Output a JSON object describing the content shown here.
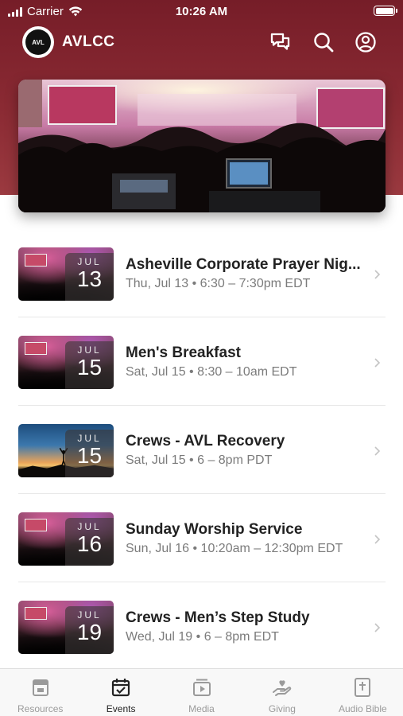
{
  "status_bar": {
    "carrier": "Carrier",
    "time": "10:26 AM"
  },
  "app_bar": {
    "logo_text": "AVL",
    "title": "AVLCC",
    "icons": [
      "chat-icon",
      "search-icon",
      "profile-icon"
    ]
  },
  "events": [
    {
      "month": "JUL",
      "day": "13",
      "title": "Asheville Corporate Prayer Nig...",
      "time": "Thu, Jul 13 • 6:30 – 7:30pm EDT",
      "thumb": "concert"
    },
    {
      "month": "JUL",
      "day": "15",
      "title": "Men's Breakfast",
      "time": "Sat, Jul 15 • 8:30 – 10am EDT",
      "thumb": "concert"
    },
    {
      "month": "JUL",
      "day": "15",
      "title": "Crews - AVL Recovery",
      "time": "Sat, Jul 15 • 6 – 8pm PDT",
      "thumb": "sunset"
    },
    {
      "month": "JUL",
      "day": "16",
      "title": "Sunday Worship Service",
      "time": "Sun, Jul 16 • 10:20am – 12:30pm EDT",
      "thumb": "concert"
    },
    {
      "month": "JUL",
      "day": "19",
      "title": "Crews - Men’s Step Study",
      "time": "Wed, Jul 19 • 6 – 8pm EDT",
      "thumb": "concert"
    }
  ],
  "tab_bar": {
    "active": "Events",
    "tabs": [
      {
        "label": "Resources",
        "icon": "resources-icon"
      },
      {
        "label": "Events",
        "icon": "calendar-icon"
      },
      {
        "label": "Media",
        "icon": "media-icon"
      },
      {
        "label": "Giving",
        "icon": "giving-icon"
      },
      {
        "label": "Audio Bible",
        "icon": "bible-icon"
      }
    ]
  },
  "colors": {
    "header": "#7f2330",
    "active_tab": "#222222",
    "inactive_tab": "#9a9a9a",
    "secondary_text": "#7b7b7b"
  }
}
